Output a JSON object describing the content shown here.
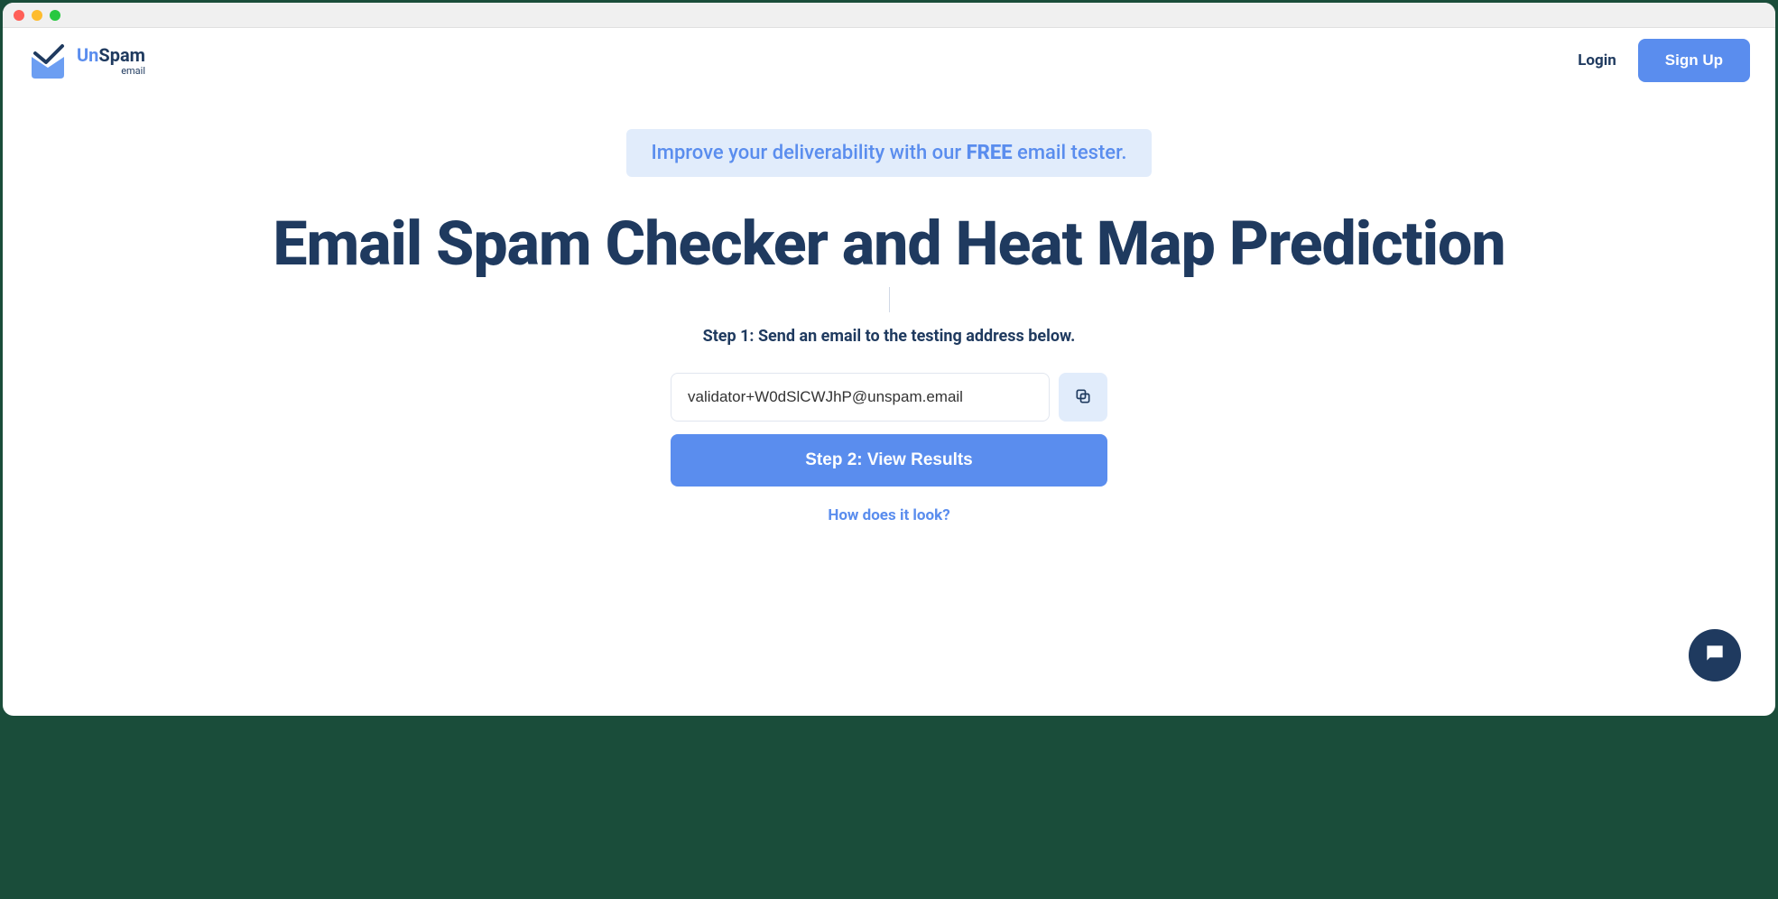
{
  "brand": {
    "un": "Un",
    "spam": "Spam",
    "sub": "email"
  },
  "nav": {
    "login": "Login",
    "signup": "Sign Up"
  },
  "banner": {
    "pre": "Improve your deliverability with our ",
    "strong": "FREE",
    "post": " email tester."
  },
  "hero": {
    "title": "Email Spam Checker and Heat Map Prediction"
  },
  "step1": {
    "label": "Step 1: Send an email to the testing address below."
  },
  "email": {
    "value": "validator+W0dSlCWJhP@unspam.email"
  },
  "step2": {
    "button": "Step 2: View Results"
  },
  "how": {
    "link": "How does it look?"
  }
}
